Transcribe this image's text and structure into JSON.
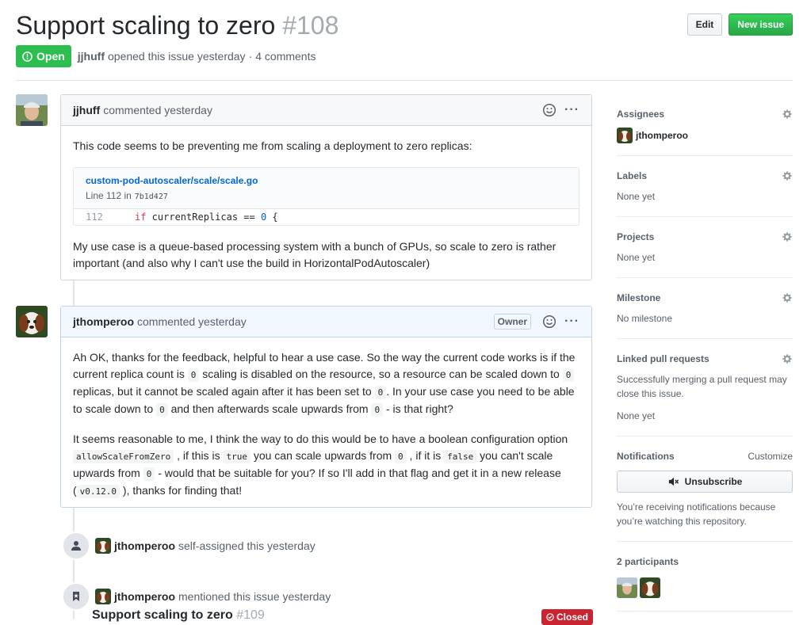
{
  "issue": {
    "title": "Support scaling to zero",
    "number": "#108",
    "state": "Open",
    "author": "jjhuff",
    "opened_text": "opened this issue yesterday",
    "separator": "·",
    "comments_count": "4 comments"
  },
  "header_actions": {
    "edit": "Edit",
    "new_issue": "New issue"
  },
  "comments": [
    {
      "author": "jjhuff",
      "action": "commented yesterday",
      "text1": "This code seems to be preventing me from scaling a deployment to zero replicas:",
      "snippet": {
        "path": "custom-pod-autoscaler/scale/scale.go",
        "line_label": "Line 112 in",
        "commit": "7b1d427",
        "line_number": "112",
        "code_kw": "if",
        "code_rest": " currentReplicas == ",
        "code_num": "0",
        "code_end": " {"
      },
      "text2": "My use case is a queue-based processing system with a bunch of GPUs, so scale to zero is rather important (and also why I can't use the build in HorizontalPodAutoscaler)"
    },
    {
      "author": "jthomperoo",
      "action": "commented yesterday",
      "owner_badge": "Owner",
      "p1": [
        "Ah OK, thanks for the feedback, helpful to hear a use case. So the way the current code works is if the current replica count is ",
        "0",
        " scaling is disabled on the resource, so a resource can be scaled down to ",
        "0",
        " replicas, but it cannot be scaled again after it has been set to ",
        "0",
        ". In your use case you need to be able to scale down to ",
        "0",
        " and then afterwards scale upwards from ",
        "0",
        " - is that right?"
      ],
      "p2": [
        "It seems reasonable to me, I think the way to do this would be to have a boolean configuration option ",
        "allowScaleFromZero",
        " , if this is ",
        "true",
        " you can scale upwards from ",
        "0",
        " , if it is ",
        "false",
        " you can't scale upwards from ",
        "0",
        " - would that be suitable for you? If so I'll add in that flag and get it in a new release (",
        "v0.12.0",
        " ), thanks for finding that!"
      ]
    }
  ],
  "events": [
    {
      "author": "jthomperoo",
      "text": "self-assigned this yesterday",
      "icon": "person-icon"
    },
    {
      "author": "jthomperoo",
      "text": "mentioned this issue yesterday",
      "icon": "bookmark-icon"
    }
  ],
  "reference": {
    "title": "Support scaling to zero",
    "number": "#109",
    "state": "Closed"
  },
  "sidebar": {
    "assignees": {
      "title": "Assignees",
      "user": "jthomperoo"
    },
    "labels": {
      "title": "Labels",
      "value": "None yet"
    },
    "projects": {
      "title": "Projects",
      "value": "None yet"
    },
    "milestone": {
      "title": "Milestone",
      "value": "No milestone"
    },
    "linked_prs": {
      "title": "Linked pull requests",
      "desc": "Successfully merging a pull request may close this issue.",
      "value": "None yet"
    },
    "notifications": {
      "title": "Notifications",
      "customize": "Customize",
      "button": "Unsubscribe",
      "desc": "You’re receiving notifications because you’re watching this repository."
    },
    "participants": {
      "title": "2 participants"
    }
  },
  "colors": {
    "open_green": "#2cbe4e",
    "closed_red": "#cb2431",
    "link_blue": "#0366d6"
  }
}
